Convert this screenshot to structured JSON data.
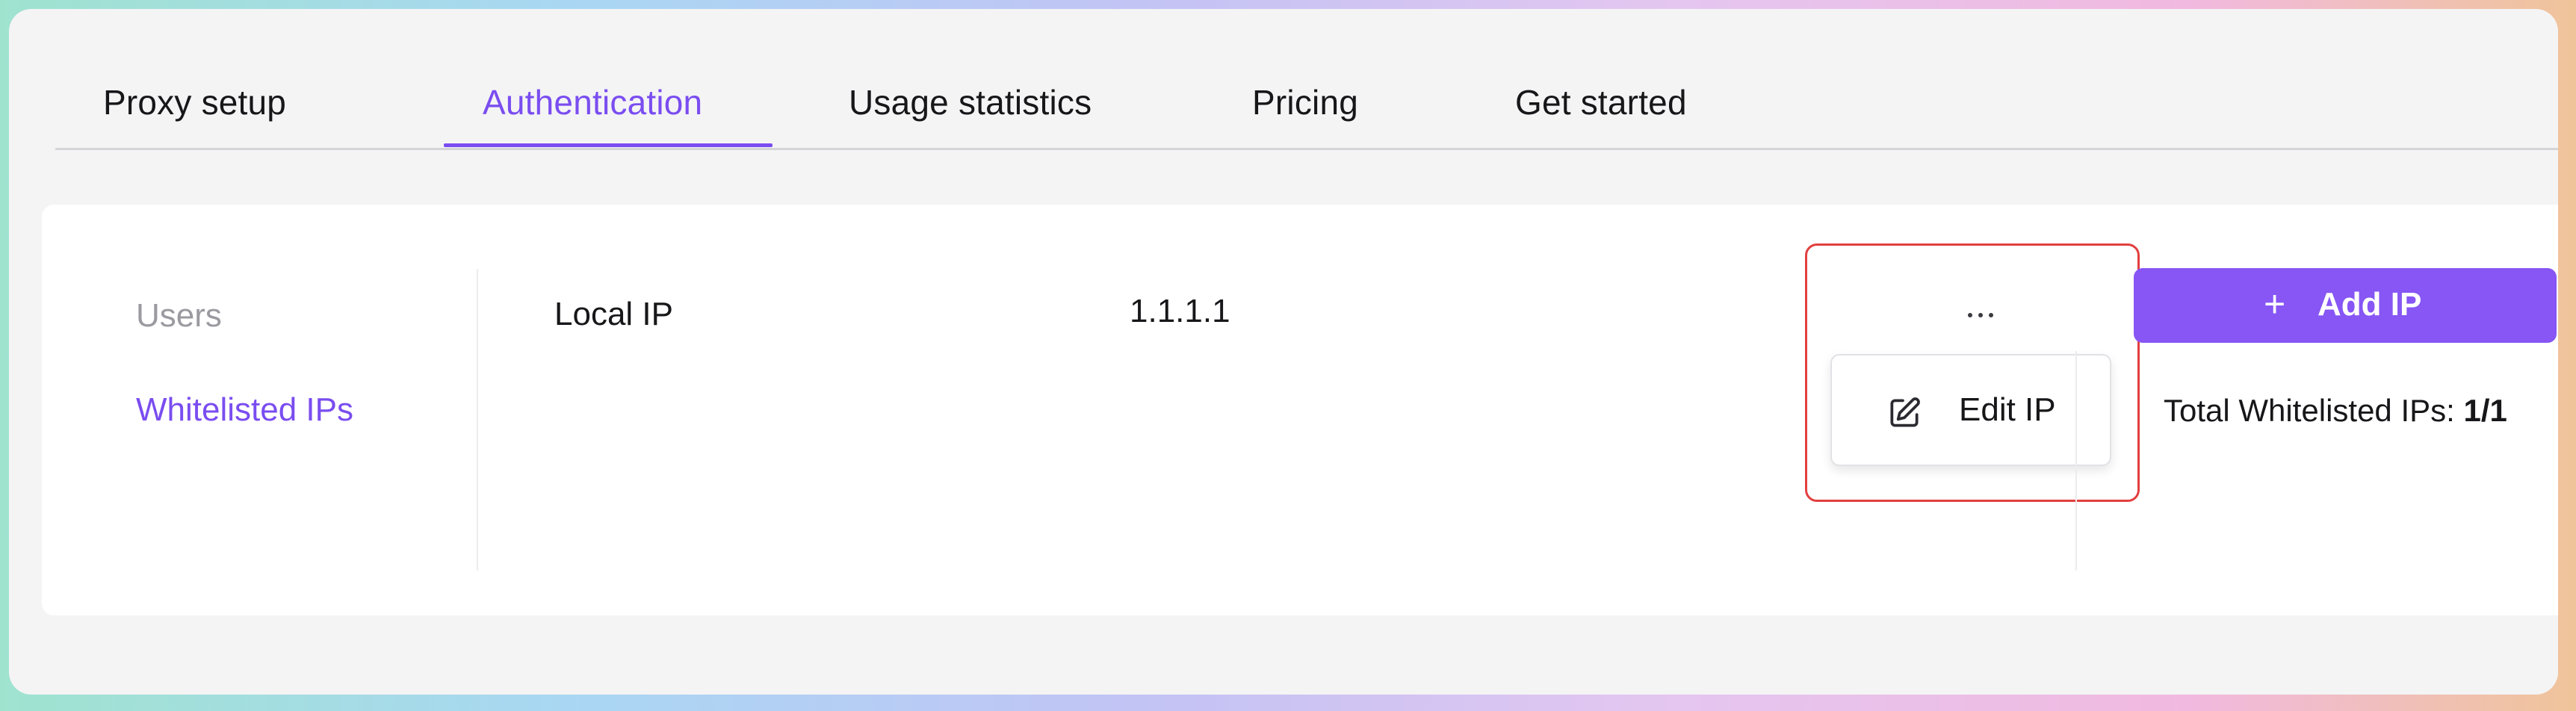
{
  "tabs": [
    {
      "label": "Proxy setup",
      "active": false
    },
    {
      "label": "Authentication",
      "active": true
    },
    {
      "label": "Usage statistics",
      "active": false
    },
    {
      "label": "Pricing",
      "active": false
    },
    {
      "label": "Get started",
      "active": false
    }
  ],
  "sidebar": {
    "items": [
      {
        "label": "Users",
        "active": false
      },
      {
        "label": "Whitelisted IPs",
        "active": true
      }
    ]
  },
  "row": {
    "name": "Local IP",
    "ip": "1.1.1.1",
    "more_icon": "ellipsis-icon"
  },
  "menu": {
    "edit_label": "Edit IP",
    "edit_icon": "edit-pencil-icon"
  },
  "actions": {
    "add_icon": "plus-icon",
    "add_label": "Add IP"
  },
  "summary": {
    "label": "Total Whitelisted IPs: ",
    "value": "1/1"
  },
  "colors": {
    "accent": "#7a4df0",
    "button": "#8756f4",
    "highlight": "#e33f3f"
  }
}
